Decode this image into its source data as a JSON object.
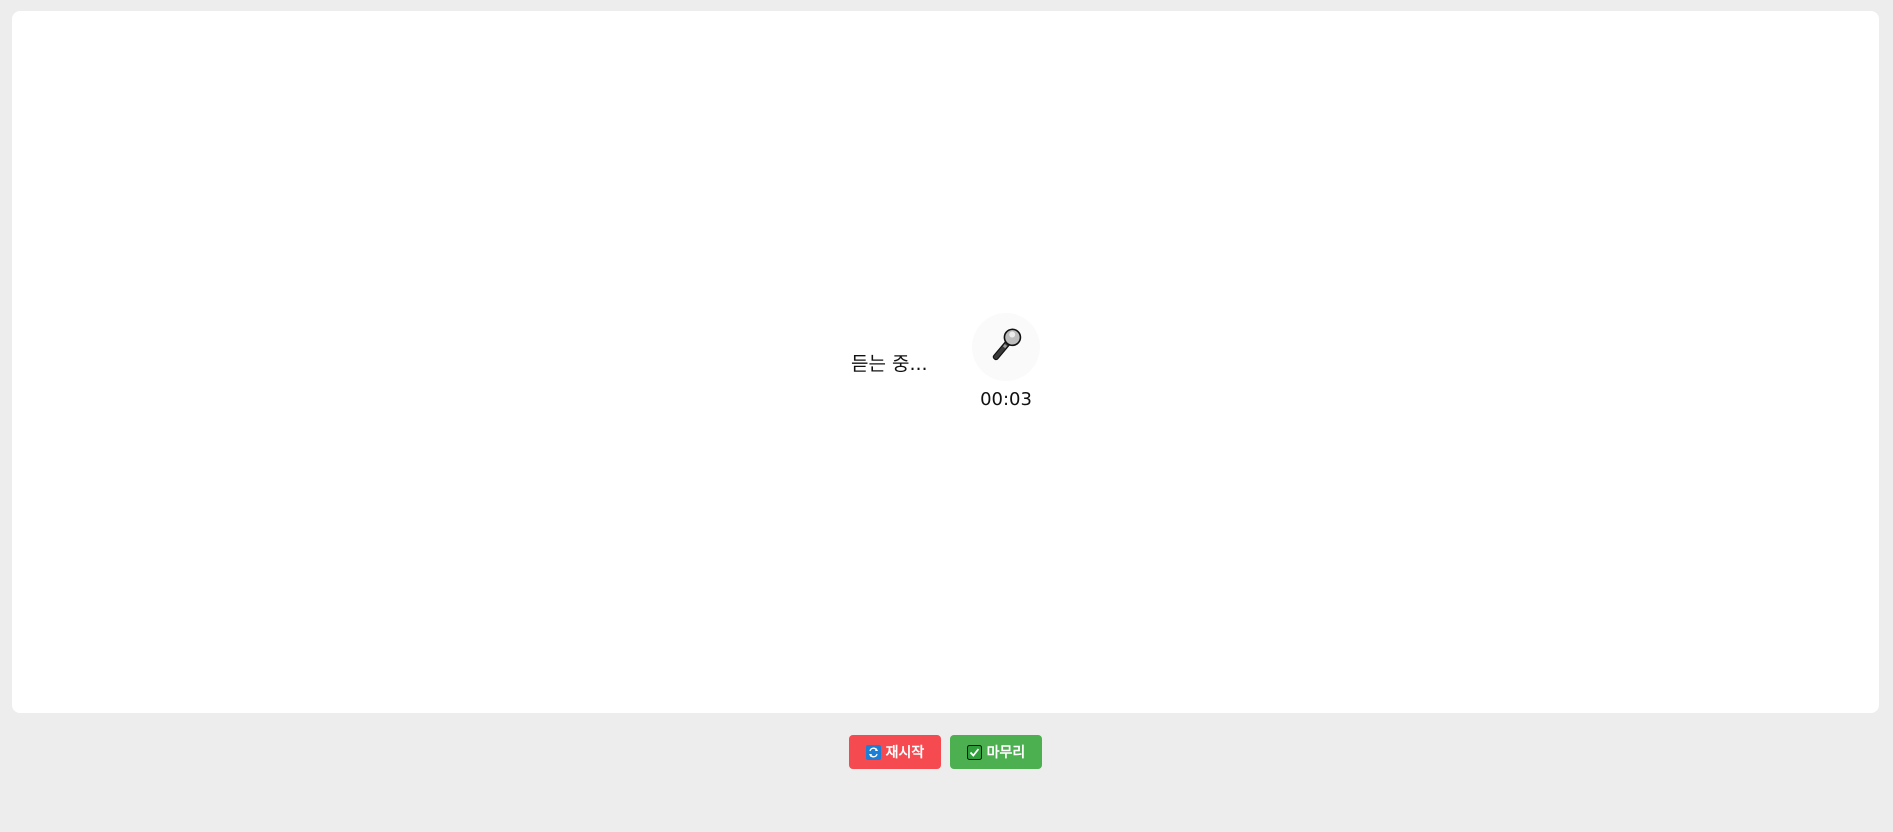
{
  "status": {
    "listening_text": "듣는 중..."
  },
  "recorder": {
    "icon": "microphone-icon",
    "elapsed_time": "00:03"
  },
  "actions": {
    "restart_label": "재시작",
    "restart_icon": "repeat-icon",
    "restart_color": "#f44a50",
    "finish_label": "마무리",
    "finish_icon": "check-mark-icon",
    "finish_color": "#4caf50"
  }
}
